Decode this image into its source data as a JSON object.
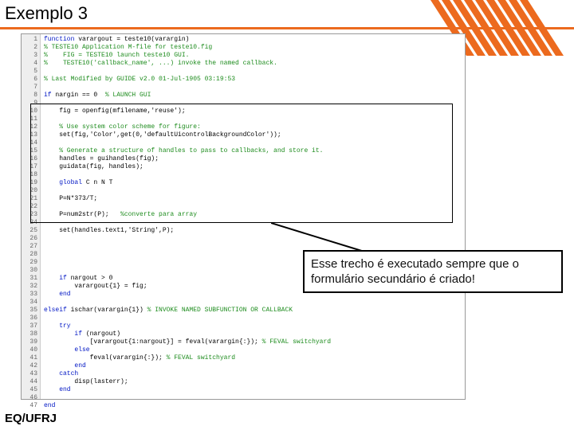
{
  "title": "Exemplo 3",
  "footer": "EQ/UFRJ",
  "callout": "Esse trecho é executado sempre que o formulário secundário é criado!",
  "gutter": " 1\n 2\n 3\n 4\n 5\n 6\n 7\n 8\n 9\n10\n11\n12\n13\n14\n15\n16\n17\n18\n19\n20\n21\n22\n23\n24\n25\n26\n27\n28\n29\n30\n31\n32\n33\n34\n35\n36\n37\n38\n39\n40\n41\n42\n43\n44\n45\n46\n47",
  "code": [
    {
      "c": "blue",
      "t": "function "
    },
    {
      "c": "",
      "t": "varargout = teste10(varargin)\n"
    },
    {
      "c": "green",
      "t": "% TESTE10 Application M-file for teste10.fig\n"
    },
    {
      "c": "green",
      "t": "%    FIG = TESTE10 launch teste10 GUI.\n"
    },
    {
      "c": "green",
      "t": "%    TESTE10('callback_name', ...) invoke the named callback.\n"
    },
    {
      "c": "",
      "t": "\n"
    },
    {
      "c": "green",
      "t": "% Last Modified by GUIDE v2.0 01-Jul-1905 03:19:53\n"
    },
    {
      "c": "",
      "t": "\n"
    },
    {
      "c": "blue",
      "t": "if "
    },
    {
      "c": "",
      "t": "nargin == 0  "
    },
    {
      "c": "green",
      "t": "% LAUNCH GUI\n"
    },
    {
      "c": "",
      "t": "\n"
    },
    {
      "c": "",
      "t": "    fig = openfig(mfilename,'reuse');\n"
    },
    {
      "c": "",
      "t": "\n"
    },
    {
      "c": "green",
      "t": "    % Use system color scheme for figure:\n"
    },
    {
      "c": "",
      "t": "    set(fig,'Color',get(0,'defaultUicontrolBackgroundColor'));\n"
    },
    {
      "c": "",
      "t": "\n"
    },
    {
      "c": "green",
      "t": "    % Generate a structure of handles to pass to callbacks, and store it.\n"
    },
    {
      "c": "",
      "t": "    handles = guihandles(fig);\n"
    },
    {
      "c": "",
      "t": "    guidata(fig, handles);\n"
    },
    {
      "c": "",
      "t": "\n"
    },
    {
      "c": "blue",
      "t": "    global"
    },
    {
      "c": "",
      "t": " C n N T\n"
    },
    {
      "c": "",
      "t": "\n"
    },
    {
      "c": "",
      "t": "    P=N*373/T;\n"
    },
    {
      "c": "",
      "t": "\n"
    },
    {
      "c": "",
      "t": "    P=num2str(P);   "
    },
    {
      "c": "green",
      "t": "%converte para array\n"
    },
    {
      "c": "",
      "t": "\n"
    },
    {
      "c": "",
      "t": "    set(handles.text1,'String',P);\n"
    },
    {
      "c": "",
      "t": "\n\n\n\n\n"
    },
    {
      "c": "blue",
      "t": "    if "
    },
    {
      "c": "",
      "t": "nargout > 0\n"
    },
    {
      "c": "",
      "t": "        varargout{1} = fig;\n"
    },
    {
      "c": "blue",
      "t": "    end\n"
    },
    {
      "c": "",
      "t": "\n"
    },
    {
      "c": "blue",
      "t": "elseif "
    },
    {
      "c": "",
      "t": "ischar(varargin{1}) "
    },
    {
      "c": "green",
      "t": "% INVOKE NAMED SUBFUNCTION OR CALLBACK\n"
    },
    {
      "c": "",
      "t": "\n"
    },
    {
      "c": "blue",
      "t": "    try\n"
    },
    {
      "c": "blue",
      "t": "        if "
    },
    {
      "c": "",
      "t": "(nargout)\n"
    },
    {
      "c": "",
      "t": "            [varargout{1:nargout}] = feval(varargin{:}); "
    },
    {
      "c": "green",
      "t": "% FEVAL switchyard\n"
    },
    {
      "c": "blue",
      "t": "        else\n"
    },
    {
      "c": "",
      "t": "            feval(varargin{:}); "
    },
    {
      "c": "green",
      "t": "% FEVAL switchyard\n"
    },
    {
      "c": "blue",
      "t": "        end\n"
    },
    {
      "c": "blue",
      "t": "    catch\n"
    },
    {
      "c": "",
      "t": "        disp(lasterr);\n"
    },
    {
      "c": "blue",
      "t": "    end\n"
    },
    {
      "c": "",
      "t": "\n"
    },
    {
      "c": "blue",
      "t": "end\n"
    }
  ]
}
